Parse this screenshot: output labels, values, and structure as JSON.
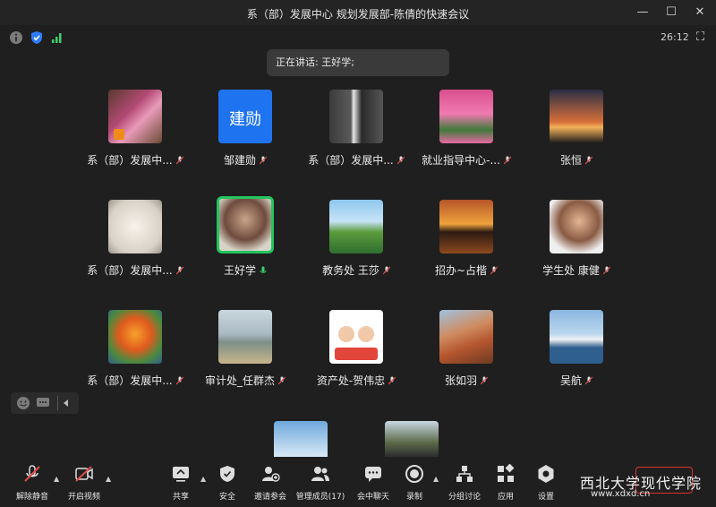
{
  "window": {
    "title": "系（部）发展中心 规划发展部-陈倩的快速会议"
  },
  "meeting": {
    "timer": "26:12",
    "speaking": "正在讲话: 王好学;"
  },
  "participants": [
    {
      "name": "系（部）发展中...",
      "avatar": "flowers"
    },
    {
      "name": "邹建勋",
      "avatar": "text"
    },
    {
      "name": "系（部）发展中...",
      "avatar": "penguin"
    },
    {
      "name": "就业指导中心-...",
      "avatar": "pink-trees"
    },
    {
      "name": "张恒",
      "avatar": "sunset-silhouette"
    },
    {
      "name": "系（部）发展中...",
      "avatar": "white-dog"
    },
    {
      "name": "王好学",
      "avatar": "man-photo"
    },
    {
      "name": "教务处 王莎",
      "avatar": "lake"
    },
    {
      "name": "招办~占楷",
      "avatar": "sunset-sea"
    },
    {
      "name": "学生处 康健",
      "avatar": "man-photo-2"
    },
    {
      "name": "系（部）发展中...",
      "avatar": "tiger-cartoon"
    },
    {
      "name": "审计处_任群杰",
      "avatar": "beach-person"
    },
    {
      "name": "资产处-贺伟忠",
      "avatar": "cartoon-couple"
    },
    {
      "name": "张如羽",
      "avatar": "rocks"
    },
    {
      "name": "吴航",
      "avatar": "ship"
    }
  ],
  "avatar_text": "建勋",
  "toolbar": {
    "unmute": "解除静音",
    "video": "开启视频",
    "share": "共享",
    "security": "安全",
    "invite": "邀请参会",
    "manage": "管理成员(17)",
    "chat": "会中聊天",
    "record": "录制",
    "breakout": "分组讨论",
    "apps": "应用",
    "settings": "设置"
  },
  "watermark": {
    "brand": "西北大学现代学院",
    "url": "www.xdxd.cn"
  },
  "colors": {
    "active_border": "#22c55e",
    "shield_blue": "#2f7bff",
    "signal_green": "#3bd16f",
    "mic_red": "#e34b4b"
  }
}
